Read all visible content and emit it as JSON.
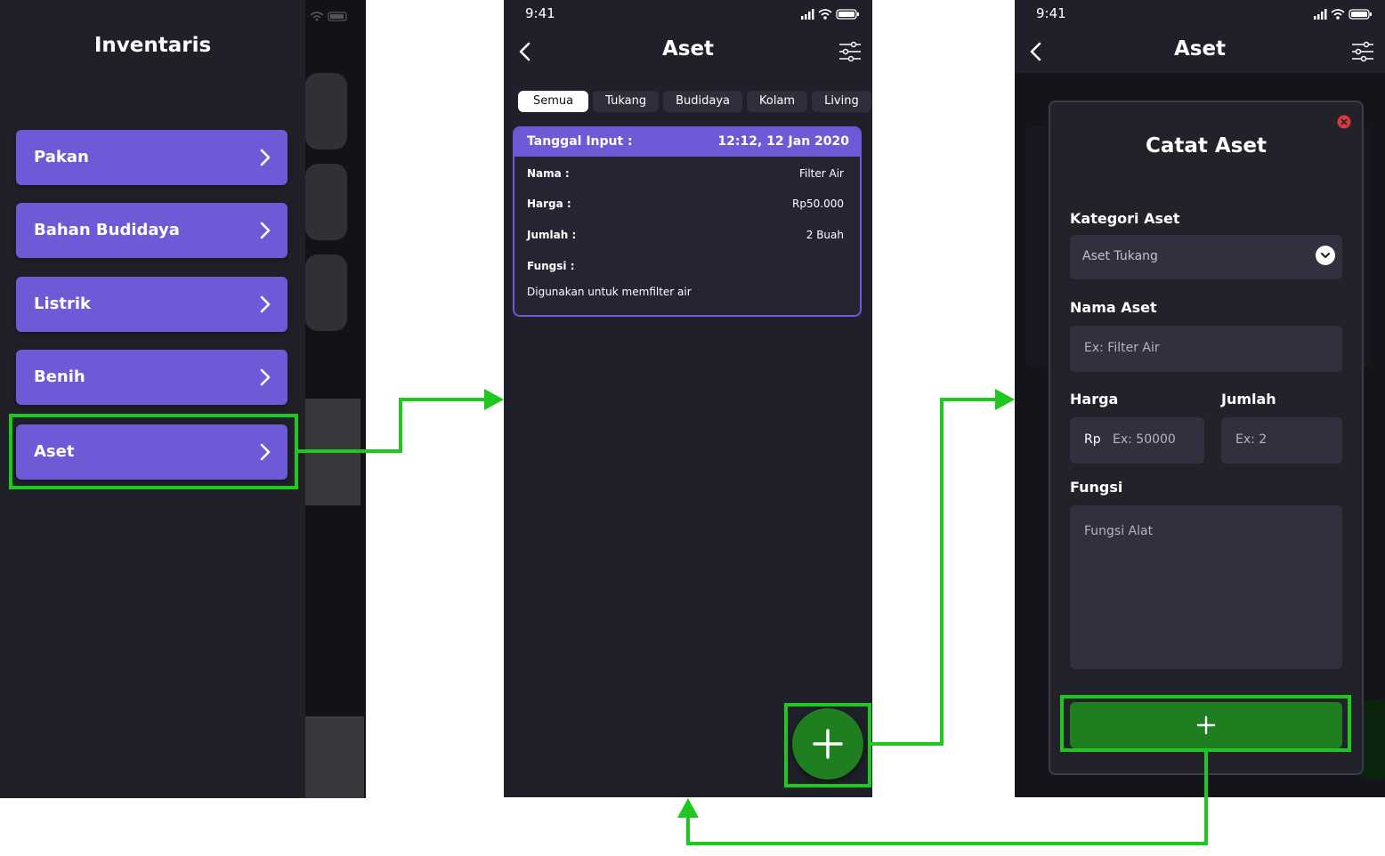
{
  "screen1": {
    "drawer_title": "Inventaris",
    "menu_items": [
      "Pakan",
      "Bahan Budidaya",
      "Listrik",
      "Benih",
      "Aset"
    ]
  },
  "screen2": {
    "status_time": "9:41",
    "title": "Aset",
    "tabs": [
      "Semua",
      "Tukang",
      "Budidaya",
      "Kolam",
      "Living"
    ],
    "active_tab": "Semua",
    "card": {
      "header_label": "Tanggal Input :",
      "header_value": "12:12, 12 Jan 2020",
      "nama_label": "Nama :",
      "nama_value": "Filter Air",
      "harga_label": "Harga :",
      "harga_value": "Rp50.000",
      "jumlah_label": "Jumlah :",
      "jumlah_value": "2 Buah",
      "fungsi_label": "Fungsi :",
      "fungsi_value": "Digunakan untuk memfilter air"
    }
  },
  "screen3": {
    "status_time": "9:41",
    "title": "Aset",
    "modal_title": "Catat Aset",
    "kategori_label": "Kategori Aset",
    "kategori_value": "Aset Tukang",
    "nama_label": "Nama Aset",
    "nama_placeholder": "Ex: Filter Air",
    "harga_label": "Harga",
    "harga_prefix": "Rp",
    "harga_placeholder": "Ex: 50000",
    "jumlah_label": "Jumlah",
    "jumlah_placeholder": "Ex: 2",
    "fungsi_label": "Fungsi",
    "fungsi_placeholder": "Fungsi Alat"
  },
  "colors": {
    "accent": "#7059d6",
    "fab_green": "#1e7e20",
    "highlight": "#1ec81e",
    "bg_dark": "#20202a"
  },
  "icons": [
    "chevron-right-icon",
    "back-arrow-icon",
    "filter-sliders-icon",
    "plus-icon",
    "close-icon",
    "dropdown-chevron-icon",
    "signal-icon",
    "wifi-icon",
    "battery-icon"
  ]
}
